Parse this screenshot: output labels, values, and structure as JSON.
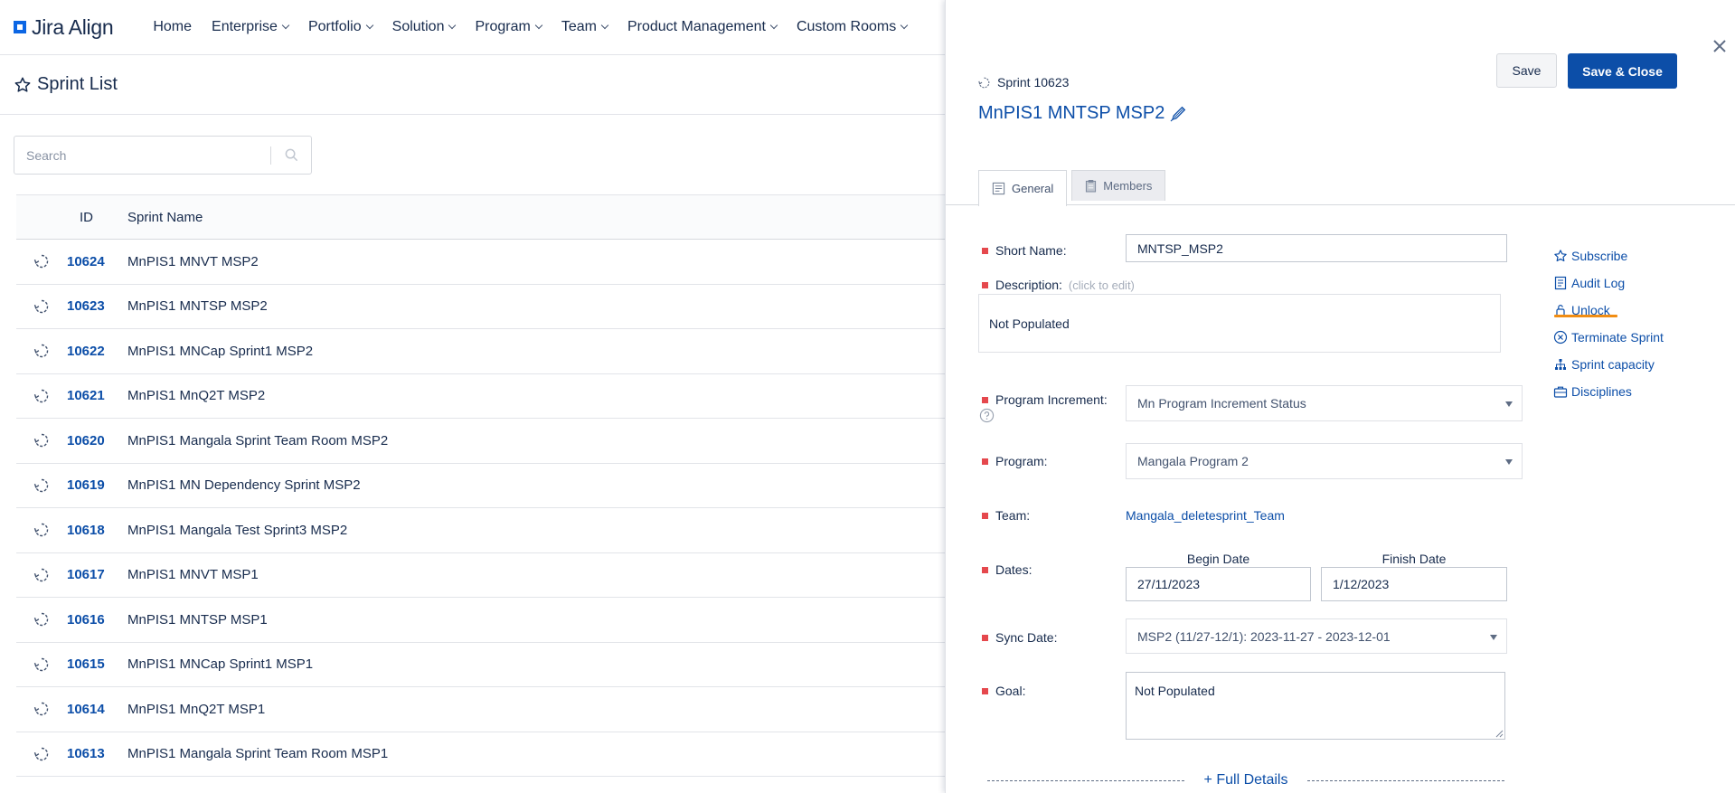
{
  "brand": {
    "name": "Jira Align"
  },
  "nav": {
    "items": [
      {
        "label": "Home",
        "has_menu": false
      },
      {
        "label": "Enterprise",
        "has_menu": true
      },
      {
        "label": "Portfolio",
        "has_menu": true
      },
      {
        "label": "Solution",
        "has_menu": true
      },
      {
        "label": "Program",
        "has_menu": true
      },
      {
        "label": "Team",
        "has_menu": true
      },
      {
        "label": "Product Management",
        "has_menu": true
      },
      {
        "label": "Custom Rooms",
        "has_menu": true
      }
    ]
  },
  "list": {
    "title": "Sprint List",
    "search_placeholder": "Search",
    "columns": {
      "id": "ID",
      "name": "Sprint Name"
    },
    "rows": [
      {
        "id": "10624",
        "name": "MnPIS1 MNVT MSP2"
      },
      {
        "id": "10623",
        "name": "MnPIS1 MNTSP MSP2"
      },
      {
        "id": "10622",
        "name": "MnPIS1 MNCap Sprint1 MSP2"
      },
      {
        "id": "10621",
        "name": "MnPIS1 MnQ2T MSP2"
      },
      {
        "id": "10620",
        "name": "MnPIS1 Mangala Sprint Team Room MSP2"
      },
      {
        "id": "10619",
        "name": "MnPIS1 MN Dependency Sprint MSP2"
      },
      {
        "id": "10618",
        "name": "MnPIS1 Mangala Test Sprint3 MSP2"
      },
      {
        "id": "10617",
        "name": "MnPIS1 MNVT MSP1"
      },
      {
        "id": "10616",
        "name": "MnPIS1 MNTSP MSP1"
      },
      {
        "id": "10615",
        "name": "MnPIS1 MNCap Sprint1 MSP1"
      },
      {
        "id": "10614",
        "name": "MnPIS1 MnQ2T MSP1"
      },
      {
        "id": "10613",
        "name": "MnPIS1 Mangala Sprint Team Room MSP1"
      }
    ]
  },
  "panel": {
    "save_label": "Save",
    "save_close_label": "Save & Close",
    "breadcrumb": "Sprint 10623",
    "title": "MnPIS1 MNTSP MSP2",
    "tabs": {
      "general": "General",
      "members": "Members"
    },
    "fields": {
      "short_name": {
        "label": "Short Name:",
        "value": "MNTSP_MSP2"
      },
      "description": {
        "label": "Description:",
        "hint": "(click to edit)",
        "value": "Not Populated"
      },
      "program_increment": {
        "label": "Program Increment:",
        "value": "Mn Program Increment Status"
      },
      "program": {
        "label": "Program:",
        "value": "Mangala Program 2"
      },
      "team": {
        "label": "Team:",
        "value": "Mangala_deletesprint_Team"
      },
      "dates": {
        "label": "Dates:",
        "begin_label": "Begin Date",
        "finish_label": "Finish Date",
        "begin_value": "27/11/2023",
        "finish_value": "1/12/2023"
      },
      "sync_date": {
        "label": "Sync Date:",
        "value": "MSP2 (11/27-12/1): 2023-11-27 - 2023-12-01"
      },
      "goal": {
        "label": "Goal:",
        "value": "Not Populated"
      }
    },
    "full_details": "+ Full Details",
    "actions": {
      "subscribe": "Subscribe",
      "audit_log": "Audit Log",
      "unlock": "Unlock",
      "terminate": "Terminate Sprint",
      "capacity": "Sprint capacity",
      "disciplines": "Disciplines"
    }
  },
  "colors": {
    "link": "#0c4ea8",
    "primary_button": "#0c4ea8",
    "required_marker": "#e5484d",
    "unlock_highlight": "#f18d13"
  }
}
